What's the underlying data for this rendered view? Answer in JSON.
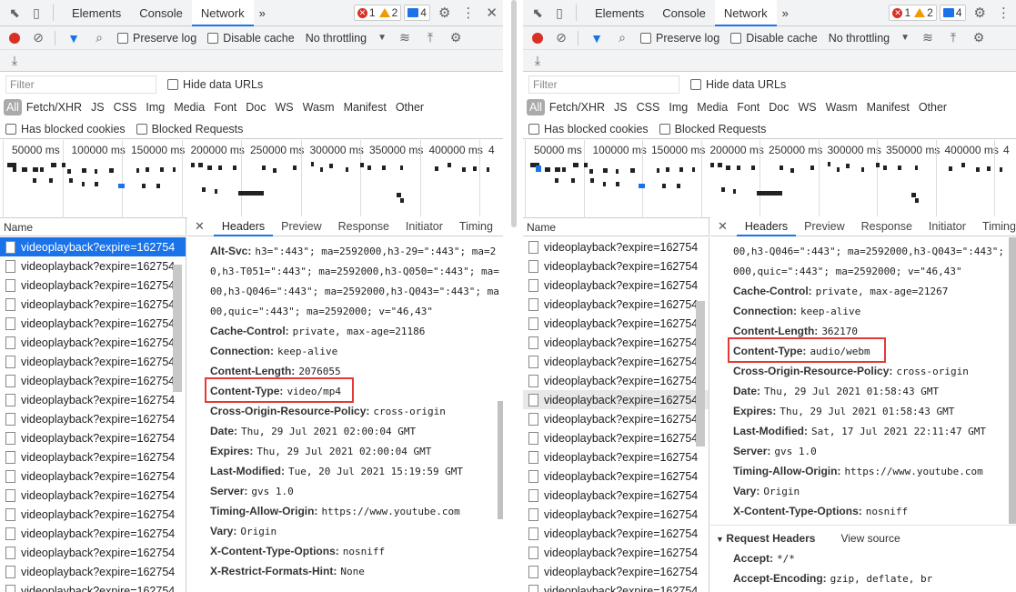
{
  "devtools": {
    "tabs": [
      "Elements",
      "Console",
      "Network"
    ],
    "active_tab": "Network",
    "more": "»",
    "errors": "1",
    "warnings": "2",
    "messages": "4",
    "close": "✕",
    "more_menu": "⋮"
  },
  "toolbar": {
    "preserve_log": "Preserve log",
    "disable_cache": "Disable cache",
    "throttling": "No throttling"
  },
  "filter": {
    "placeholder": "Filter",
    "hide_data_urls": "Hide data URLs",
    "types": [
      "All",
      "Fetch/XHR",
      "JS",
      "CSS",
      "Img",
      "Media",
      "Font",
      "Doc",
      "WS",
      "Wasm",
      "Manifest",
      "Other"
    ],
    "has_blocked_cookies": "Has blocked cookies",
    "blocked_requests": "Blocked Requests"
  },
  "overview": {
    "ticks": [
      "50000 ms",
      "100000 ms",
      "150000 ms",
      "200000 ms",
      "250000 ms",
      "300000 ms",
      "350000 ms",
      "400000 ms",
      "4"
    ]
  },
  "requests": {
    "name_header": "Name",
    "item_label": "videoplayback?expire=162754"
  },
  "details": {
    "close": "✕",
    "tabs": [
      "Headers",
      "Preview",
      "Response",
      "Initiator",
      "Timing"
    ]
  },
  "left": {
    "headers": [
      {
        "k": "Alt-Svc:",
        "v": "h3=\":443\"; ma=2592000,h3-29=\":443\"; ma=2"
      },
      {
        "k": "",
        "v": "0,h3-T051=\":443\"; ma=2592000,h3-Q050=\":443\"; ma="
      },
      {
        "k": "",
        "v": "00,h3-Q046=\":443\"; ma=2592000,h3-Q043=\":443\"; ma"
      },
      {
        "k": "",
        "v": "00,quic=\":443\"; ma=2592000; v=\"46,43\""
      },
      {
        "k": "Cache-Control:",
        "v": "private, max-age=21186"
      },
      {
        "k": "Connection:",
        "v": "keep-alive"
      },
      {
        "k": "Content-Length:",
        "v": "2076055"
      },
      {
        "k": "Content-Type:",
        "v": "video/mp4"
      },
      {
        "k": "Cross-Origin-Resource-Policy:",
        "v": "cross-origin"
      },
      {
        "k": "Date:",
        "v": "Thu, 29 Jul 2021 02:00:04 GMT"
      },
      {
        "k": "Expires:",
        "v": "Thu, 29 Jul 2021 02:00:04 GMT"
      },
      {
        "k": "Last-Modified:",
        "v": "Tue, 20 Jul 2021 15:19:59 GMT"
      },
      {
        "k": "Server:",
        "v": "gvs 1.0"
      },
      {
        "k": "Timing-Allow-Origin:",
        "v": "https://www.youtube.com"
      },
      {
        "k": "Vary:",
        "v": "Origin"
      },
      {
        "k": "X-Content-Type-Options:",
        "v": "nosniff"
      },
      {
        "k": "X-Restrict-Formats-Hint:",
        "v": "None"
      }
    ]
  },
  "right": {
    "headers": [
      {
        "k": "",
        "v": "00,h3-Q046=\":443\"; ma=2592000,h3-Q043=\":443\"; ma="
      },
      {
        "k": "",
        "v": "000,quic=\":443\"; ma=2592000; v=\"46,43\""
      },
      {
        "k": "Cache-Control:",
        "v": "private, max-age=21267"
      },
      {
        "k": "Connection:",
        "v": "keep-alive"
      },
      {
        "k": "Content-Length:",
        "v": "362170"
      },
      {
        "k": "Content-Type:",
        "v": "audio/webm"
      },
      {
        "k": "Cross-Origin-Resource-Policy:",
        "v": "cross-origin"
      },
      {
        "k": "Date:",
        "v": "Thu, 29 Jul 2021 01:58:43 GMT"
      },
      {
        "k": "Expires:",
        "v": "Thu, 29 Jul 2021 01:58:43 GMT"
      },
      {
        "k": "Last-Modified:",
        "v": "Sat, 17 Jul 2021 22:11:47 GMT"
      },
      {
        "k": "Server:",
        "v": "gvs 1.0"
      },
      {
        "k": "Timing-Allow-Origin:",
        "v": "https://www.youtube.com"
      },
      {
        "k": "Vary:",
        "v": "Origin"
      },
      {
        "k": "X-Content-Type-Options:",
        "v": "nosniff"
      }
    ],
    "request_headers_title": "Request Headers",
    "view_source": "View source",
    "request_headers": [
      {
        "k": "Accept:",
        "v": "*/*"
      },
      {
        "k": "Accept-Encoding:",
        "v": "gzip, deflate, br"
      }
    ]
  }
}
